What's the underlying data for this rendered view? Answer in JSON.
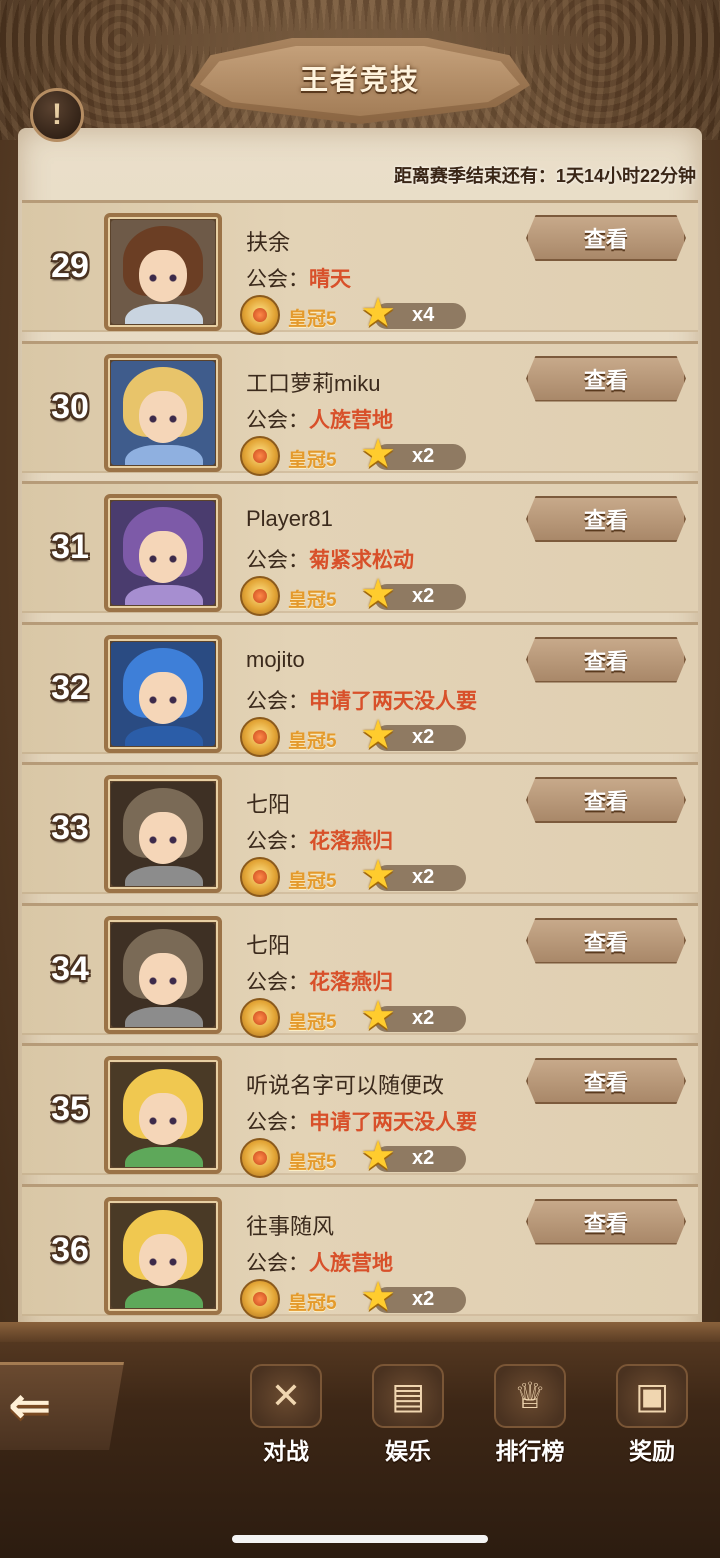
{
  "header": {
    "title": "王者竞技",
    "info_icon": "exclamation-icon",
    "info_glyph": "!",
    "season_countdown": "距离赛季结束还有：1天14小时22分钟"
  },
  "labels": {
    "guild_prefix": "公会：",
    "crown_rank": "皇冠5",
    "view_button": "查看"
  },
  "rows": [
    {
      "rank": "29",
      "name": "扶余",
      "guild": "晴天",
      "stars": "x4",
      "hair": "#6b3e24",
      "body": "#c9d4e0",
      "bg": "#6e5a48"
    },
    {
      "rank": "30",
      "name": "工口萝莉miku",
      "guild": "人族营地",
      "stars": "x2",
      "hair": "#e8c46a",
      "body": "#8fb0e0",
      "bg": "#3f5c8c"
    },
    {
      "rank": "31",
      "name": "Player81",
      "guild": "菊紧求松动",
      "stars": "x2",
      "hair": "#7d5aa8",
      "body": "#a68ed0",
      "bg": "#4a3c6e"
    },
    {
      "rank": "32",
      "name": "mojito",
      "guild": "申请了两天没人要",
      "stars": "x2",
      "hair": "#3e7fd8",
      "body": "#2b5da8",
      "bg": "#2a4b82"
    },
    {
      "rank": "33",
      "name": "七阳",
      "guild": "花落燕归",
      "stars": "x2",
      "hair": "#7a6a56",
      "body": "#8c8c8c",
      "bg": "#3e3024"
    },
    {
      "rank": "34",
      "name": "七阳",
      "guild": "花落燕归",
      "stars": "x2",
      "hair": "#7a6a56",
      "body": "#8c8c8c",
      "bg": "#3e3024"
    },
    {
      "rank": "35",
      "name": "听说名字可以随便改",
      "guild": "申请了两天没人要",
      "stars": "x2",
      "hair": "#f0c850",
      "body": "#5ea85a",
      "bg": "#4a3a26"
    },
    {
      "rank": "36",
      "name": "往事随风",
      "guild": "人族营地",
      "stars": "x2",
      "hair": "#f0c850",
      "body": "#5ea85a",
      "bg": "#4a3a26"
    }
  ],
  "nav": {
    "back_icon": "back-arrow-icon",
    "back_glyph": "⇐",
    "items": [
      {
        "label": "对战",
        "icon": "battle-icon",
        "glyph": "✕"
      },
      {
        "label": "娱乐",
        "icon": "entertainment-icon",
        "glyph": "▤"
      },
      {
        "label": "排行榜",
        "icon": "trophy-icon",
        "glyph": "♕"
      },
      {
        "label": "奖励",
        "icon": "chest-icon",
        "glyph": "▣"
      }
    ]
  },
  "colors": {
    "guild_text": "#d8502a",
    "crown_text": "#e49a2c",
    "star": "#ffcc2e"
  }
}
